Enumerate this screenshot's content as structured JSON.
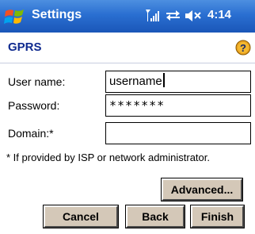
{
  "titlebar": {
    "app_title": "Settings",
    "time": "4:14",
    "icons": [
      "start-windows-logo",
      "signal-strength-icon",
      "connectivity-icon",
      "speaker-muted-icon"
    ],
    "color": "#2a6fd1"
  },
  "header": {
    "title": "GPRS",
    "help_icon": "help-question-icon",
    "title_color": "#0f2a8f"
  },
  "form": {
    "username_label": "User name:",
    "username_value": "username",
    "password_label": "Password:",
    "password_value": "*******",
    "domain_label": "Domain:*",
    "domain_value": ""
  },
  "footnote": "* If provided by ISP or network administrator.",
  "buttons": {
    "advanced": "Advanced...",
    "cancel": "Cancel",
    "back": "Back",
    "finish": "Finish"
  }
}
